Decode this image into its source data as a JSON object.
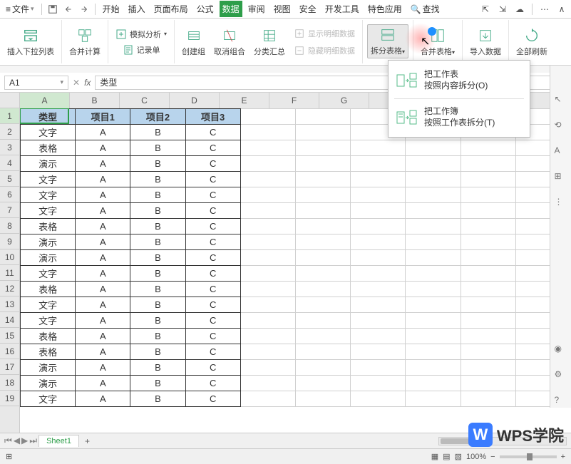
{
  "menu": {
    "file": "文件",
    "tabs": [
      "开始",
      "插入",
      "页面布局",
      "公式",
      "数据",
      "审阅",
      "视图",
      "安全",
      "开发工具",
      "特色应用"
    ],
    "active_tab_index": 4,
    "search": "查找"
  },
  "ribbon": {
    "dropdown_col": "插入下拉列表",
    "merge_calc": "合并计算",
    "sim_analysis": "模拟分析",
    "record_form": "记录单",
    "create_group": "创建组",
    "ungroup": "取消组合",
    "subtotal": "分类汇总",
    "show_detail": "显示明细数据",
    "hide_detail": "隐藏明细数据",
    "split_table": "拆分表格",
    "merge_table": "合并表格",
    "import_data": "导入数据",
    "refresh_all": "全部刷新"
  },
  "formula": {
    "cell_ref": "A1",
    "fx": "fx",
    "value": "类型"
  },
  "columns": [
    "A",
    "B",
    "C",
    "D",
    "E",
    "F",
    "G"
  ],
  "rows": [
    "1",
    "2",
    "3",
    "4",
    "5",
    "6",
    "7",
    "8",
    "9",
    "10",
    "11",
    "12",
    "13",
    "14",
    "15",
    "16",
    "17",
    "18",
    "19"
  ],
  "headers": [
    "类型",
    "项目1",
    "项目2",
    "项目3"
  ],
  "data": [
    [
      "文字",
      "A",
      "B",
      "C"
    ],
    [
      "表格",
      "A",
      "B",
      "C"
    ],
    [
      "演示",
      "A",
      "B",
      "C"
    ],
    [
      "文字",
      "A",
      "B",
      "C"
    ],
    [
      "文字",
      "A",
      "B",
      "C"
    ],
    [
      "文字",
      "A",
      "B",
      "C"
    ],
    [
      "表格",
      "A",
      "B",
      "C"
    ],
    [
      "演示",
      "A",
      "B",
      "C"
    ],
    [
      "演示",
      "A",
      "B",
      "C"
    ],
    [
      "文字",
      "A",
      "B",
      "C"
    ],
    [
      "表格",
      "A",
      "B",
      "C"
    ],
    [
      "文字",
      "A",
      "B",
      "C"
    ],
    [
      "文字",
      "A",
      "B",
      "C"
    ],
    [
      "表格",
      "A",
      "B",
      "C"
    ],
    [
      "表格",
      "A",
      "B",
      "C"
    ],
    [
      "演示",
      "A",
      "B",
      "C"
    ],
    [
      "演示",
      "A",
      "B",
      "C"
    ],
    [
      "文字",
      "A",
      "B",
      "C"
    ]
  ],
  "sheet_tab": "Sheet1",
  "zoom": "100%",
  "dropdown": {
    "item1_title": "把工作表",
    "item1_sub": "按照内容拆分(O)",
    "item2_title": "把工作簿",
    "item2_sub": "按照工作表拆分(T)"
  },
  "logo": "WPS学院"
}
